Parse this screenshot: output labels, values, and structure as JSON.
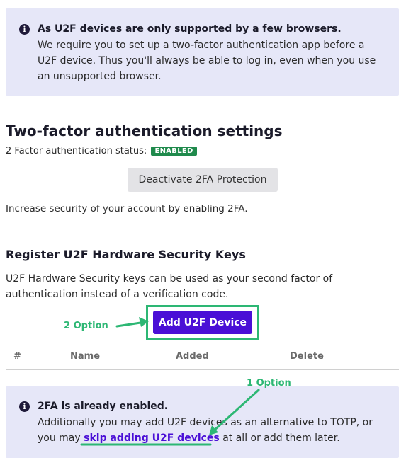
{
  "top_notice": {
    "title": "As U2F devices are only supported by a few browsers.",
    "body": "We require you to set up a two-factor authentication app before a U2F device. Thus you'll always be able to log in, even when you use an unsupported browser."
  },
  "twofa": {
    "title": "Two-factor authentication settings",
    "status_label": "2 Factor authentication status:",
    "status_badge": "ENABLED",
    "deactivate_label": "Deactivate 2FA Protection",
    "increase_text": "Increase security of your account by enabling 2FA."
  },
  "u2f": {
    "title": "Register U2F Hardware Security Keys",
    "description": "U2F Hardware Security keys can be used as your second factor of authentication instead of a verification code.",
    "add_label": "Add U2F Device",
    "table_headers": [
      "#",
      "Name",
      "Added",
      "Delete"
    ]
  },
  "annotations": {
    "option_2": "2 Option",
    "option_1": "1 Option",
    "color": "#2db774"
  },
  "bottom_notice": {
    "title": "2FA is already enabled.",
    "body_before": "Additionally you may add U2F devices as an alternative to TOTP, or you may ",
    "link": "skip adding U2F devices",
    "body_after": " at all or add them later."
  },
  "icons": {
    "info": "info-circle-icon"
  },
  "colors": {
    "accent": "#4a0fd6",
    "badge": "#1f8a4c",
    "callout_bg": "#e6e7f8"
  }
}
